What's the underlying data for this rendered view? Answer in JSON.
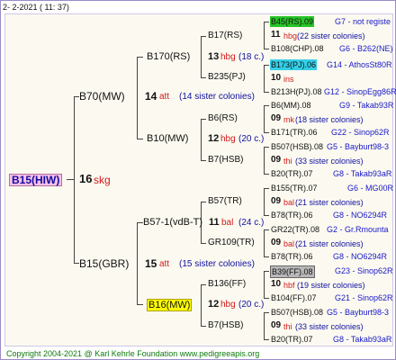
{
  "header": {
    "date": "2-  2-2021  ( 11:  37)"
  },
  "footer": {
    "copyright": "Copyright 2004-2021 @ Karl Kehrle Foundation   www.pedigreeapis.org"
  },
  "colors": {
    "yellow_highlight": "#ffff00",
    "green_highlight": "#27c427",
    "cyan_highlight": "#33cfe8",
    "gray_highlight": "#b8b8b8",
    "pink_highlight": "#ffc0e8"
  },
  "root": {
    "code": "B15(HIW)",
    "number": "16",
    "suffix": "skg"
  },
  "g1": [
    {
      "code": "B70(MW)",
      "number": "14",
      "suffix": "att",
      "colonies": "(14 sister colonies)"
    },
    {
      "code": "B15(GBR)",
      "number": "15",
      "suffix": "att",
      "colonies": "(15 sister colonies)"
    }
  ],
  "g2": [
    {
      "code": "B170(RS)",
      "number": "13",
      "suffix": "hbg",
      "colonies": "(18 c.)"
    },
    {
      "code": "B10(MW)",
      "number": "12",
      "suffix": "hbg",
      "colonies": "(20 c.)"
    },
    {
      "code": "B57-1(vdB-T)",
      "number": "11",
      "suffix": "bal",
      "colonies": "(24 c.)"
    },
    {
      "code": "B16(MW)",
      "number": "12",
      "suffix": "hbg",
      "colonies": "(20 c.)"
    }
  ],
  "g3": [
    {
      "code": "B17(RS)"
    },
    {
      "code": "B235(PJ)"
    },
    {
      "code": "B6(RS)"
    },
    {
      "code": "B7(HSB)"
    },
    {
      "code": "B57(TR)"
    },
    {
      "code": "GR109(TR)"
    },
    {
      "code": "B136(FF)"
    },
    {
      "code": "B7(HSB)"
    }
  ],
  "g4": [
    {
      "code": "B45(RS).09",
      "ref": "G7 - not registe",
      "number": "11",
      "suffix": "hbg",
      "colonies": "(22 sister colonies)",
      "mother": "B108(CHP).08",
      "mref": "G6 - B262(NE)"
    },
    {
      "code": "B173(PJ).06",
      "ref": "G14 - AthosSt80R",
      "number": "10",
      "suffix": "ins",
      "colonies": "",
      "mother": "B213H(PJ).08",
      "mref": "G12 - SinopEgg86R"
    },
    {
      "code": "B6(MM).08",
      "ref": "G9 - Takab93R",
      "number": "09",
      "suffix": "mk",
      "colonies": "(18 sister colonies)",
      "mother": "B171(TR).06",
      "mref": "G22 - Sinop62R"
    },
    {
      "code": "B507(HSB).08",
      "ref": "G5 - Bayburt98-3",
      "number": "09",
      "suffix": "thi",
      "colonies": "(33 sister colonies)",
      "mother": "B20(TR).07",
      "mref": "G8 - Takab93aR"
    },
    {
      "code": "B155(TR).07",
      "ref": "G6 - MG00R",
      "number": "09",
      "suffix": "bal",
      "colonies": "(21 sister colonies)",
      "mother": "B78(TR).06",
      "mref": "G8 - NO6294R"
    },
    {
      "code": "GR22(TR).08",
      "ref": "G2 - Gr.Rmounta",
      "number": "09",
      "suffix": "bal",
      "colonies": "(21 sister colonies)",
      "mother": "B78(TR).06",
      "mref": "G8 - NO6294R"
    },
    {
      "code": "B39(FF).08",
      "ref": "G23 - Sinop62R",
      "number": "10",
      "suffix": "hbf",
      "colonies": "(19 sister colonies)",
      "mother": "B104(FF).07",
      "mref": "G21 - Sinop62R"
    },
    {
      "code": "B507(HSB).08",
      "ref": "G5 - Bayburt98-3",
      "number": "09",
      "suffix": "thi",
      "colonies": "(33 sister colonies)",
      "mother": "B20(TR).07",
      "mref": "G8 - Takab93aR"
    }
  ]
}
